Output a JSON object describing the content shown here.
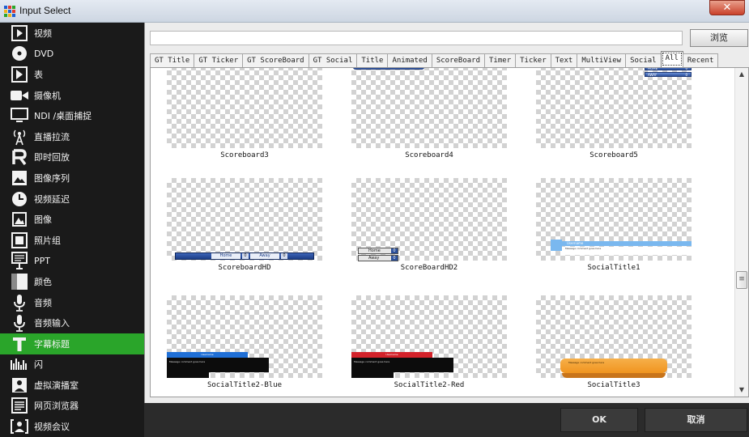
{
  "window": {
    "title": "Input Select",
    "close_label": "✕"
  },
  "sidebar": {
    "items": [
      {
        "label": "视频",
        "icon": "video-file-icon"
      },
      {
        "label": "DVD",
        "icon": "dvd-disc-icon"
      },
      {
        "label": "表",
        "icon": "table-play-icon"
      },
      {
        "label": "摄像机",
        "icon": "camera-icon"
      },
      {
        "label": "NDI /桌面捕捉",
        "icon": "monitor-icon"
      },
      {
        "label": "直播拉流",
        "icon": "broadcast-antenna-icon"
      },
      {
        "label": "即时回放",
        "icon": "replay-icon"
      },
      {
        "label": "图像序列",
        "icon": "image-sequence-icon"
      },
      {
        "label": "视频延迟",
        "icon": "clock-icon"
      },
      {
        "label": "图像",
        "icon": "image-icon"
      },
      {
        "label": "照片组",
        "icon": "photo-group-icon"
      },
      {
        "label": "PPT",
        "icon": "presentation-icon"
      },
      {
        "label": "颜色",
        "icon": "color-icon"
      },
      {
        "label": "音频",
        "icon": "microphone-icon"
      },
      {
        "label": "音频输入",
        "icon": "audio-input-icon"
      },
      {
        "label": "字幕标题",
        "icon": "title-text-icon",
        "active": true
      },
      {
        "label": "闪",
        "icon": "flash-icon"
      },
      {
        "label": "虚拟演播室",
        "icon": "virtual-studio-icon"
      },
      {
        "label": "网页浏览器",
        "icon": "web-browser-icon"
      },
      {
        "label": "视频会议",
        "icon": "video-call-icon"
      }
    ]
  },
  "toolbar": {
    "path_value": "",
    "browse_label": "浏览"
  },
  "tabs": [
    {
      "label": "GT Title"
    },
    {
      "label": "GT Ticker"
    },
    {
      "label": "GT ScoreBoard"
    },
    {
      "label": "GT Social"
    },
    {
      "label": "Title"
    },
    {
      "label": "Animated"
    },
    {
      "label": "ScoreBoard"
    },
    {
      "label": "Timer"
    },
    {
      "label": "Ticker"
    },
    {
      "label": "Text"
    },
    {
      "label": "MultiView"
    },
    {
      "label": "Social"
    },
    {
      "label": "All",
      "active": true
    },
    {
      "label": "Recent"
    }
  ],
  "templates": [
    {
      "label": "Scoreboard3",
      "graphic": "none"
    },
    {
      "label": "Scoreboard4",
      "graphic": "scoreboard4"
    },
    {
      "label": "Scoreboard5",
      "graphic": "scoreboard5"
    },
    {
      "label": "ScoreboardHD",
      "graphic": "scoreboardhd"
    },
    {
      "label": "ScoreBoardHD2",
      "graphic": "scoreboardhd2"
    },
    {
      "label": "SocialTitle1",
      "graphic": "socialtitle1"
    },
    {
      "label": "SocialTitle2-Blue",
      "graphic": "social-blue"
    },
    {
      "label": "SocialTitle2-Red",
      "graphic": "social-red"
    },
    {
      "label": "SocialTitle3",
      "graphic": "social-orange"
    }
  ],
  "graphic_text": {
    "home": "Home",
    "away": "Away",
    "home_caps": "HOME",
    "away_caps": "AWAY",
    "score_zero": "0",
    "username": "Username",
    "message": "Message comment goes here"
  },
  "footer": {
    "ok_label": "OK",
    "cancel_label": "取消"
  },
  "colors": {
    "sidebar_active": "#2aa52a",
    "scoreboard_blue": "#2a4f9a",
    "social_blue": "#1f6fd6",
    "social_red": "#d3222a",
    "social_orange": "#f0941f",
    "social_light_blue": "#7ab8ef"
  }
}
